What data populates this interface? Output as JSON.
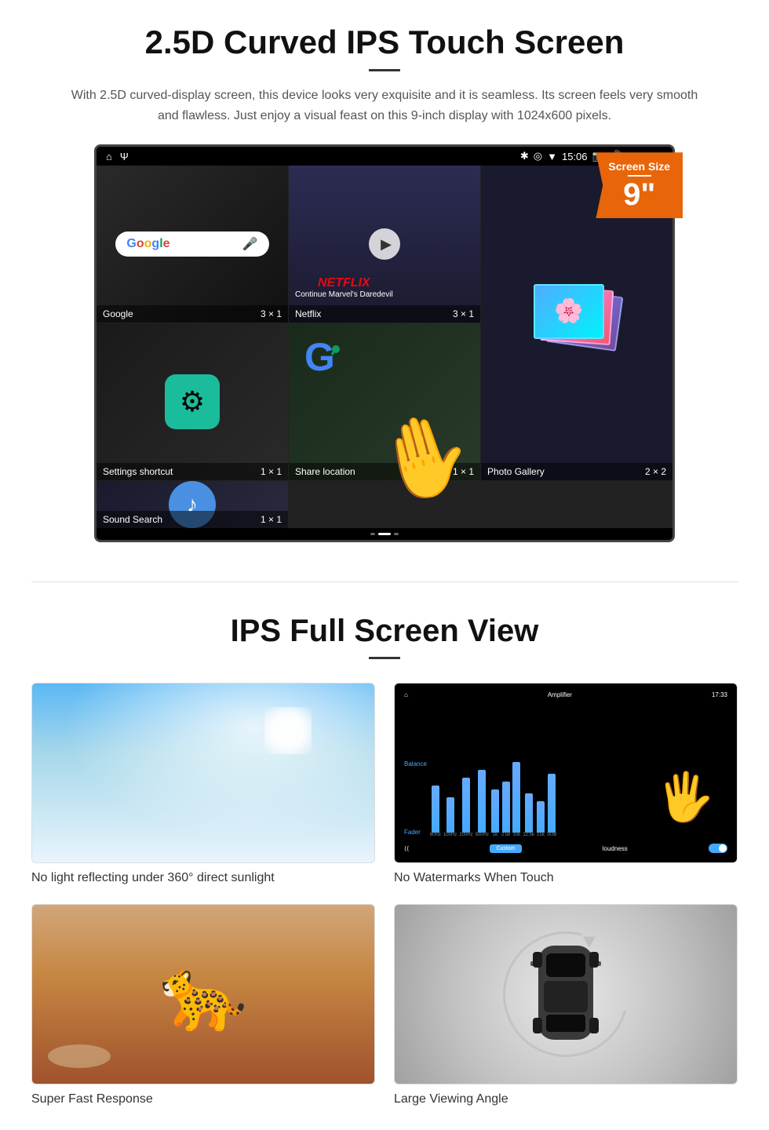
{
  "section1": {
    "title": "2.5D Curved IPS Touch Screen",
    "description": "With 2.5D curved-display screen, this device looks very exquisite and it is seamless. Its screen feels very smooth and flawless. Just enjoy a visual feast on this 9-inch display with 1024x600 pixels.",
    "badge": {
      "title": "Screen Size",
      "size": "9\""
    },
    "status_bar": {
      "time": "15:06"
    },
    "apps": [
      {
        "name": "Google",
        "size": "3 × 1",
        "type": "google"
      },
      {
        "name": "Netflix",
        "size": "3 × 1",
        "type": "netflix",
        "subtitle": "Continue Marvel's Daredevil"
      },
      {
        "name": "Photo Gallery",
        "size": "2 × 2",
        "type": "gallery"
      },
      {
        "name": "Settings shortcut",
        "size": "1 × 1",
        "type": "settings"
      },
      {
        "name": "Share location",
        "size": "1 × 1",
        "type": "share"
      },
      {
        "name": "Sound Search",
        "size": "1 × 1",
        "type": "sound"
      }
    ]
  },
  "section2": {
    "title": "IPS Full Screen View",
    "items": [
      {
        "caption": "No light reflecting under 360° direct sunlight",
        "type": "sunlight"
      },
      {
        "caption": "No Watermarks When Touch",
        "type": "amplifier"
      },
      {
        "caption": "Super Fast Response",
        "type": "cheetah"
      },
      {
        "caption": "Large Viewing Angle",
        "type": "car"
      }
    ]
  }
}
